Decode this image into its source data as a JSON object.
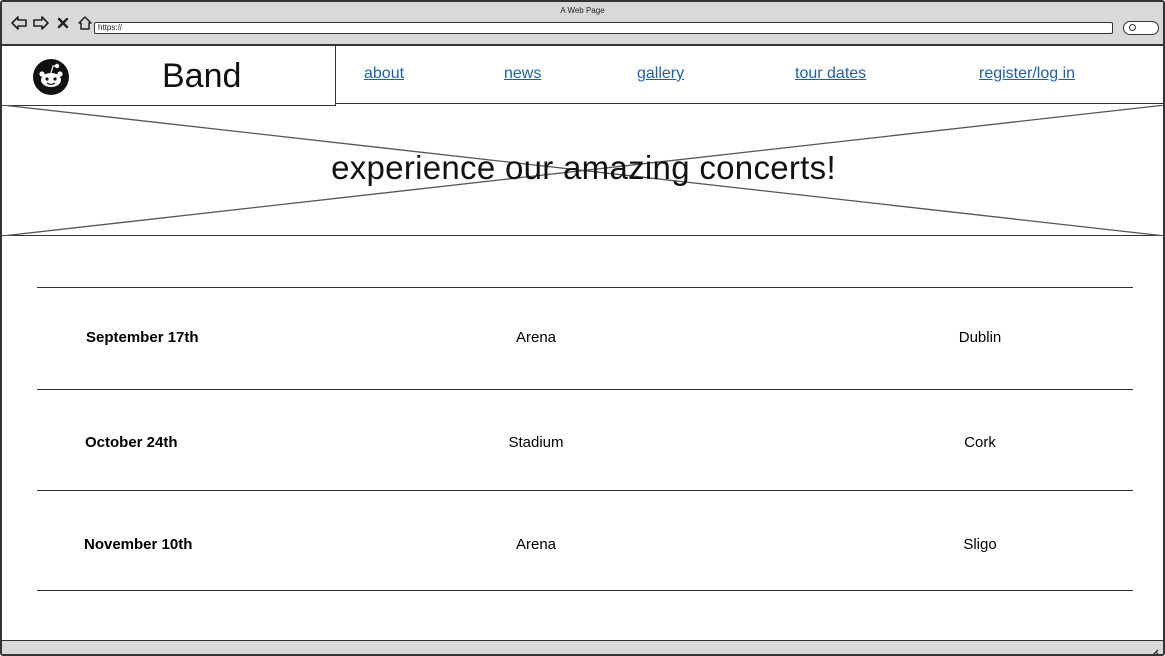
{
  "window": {
    "title": "A Web Page"
  },
  "browser": {
    "url": "https://",
    "nav_icons": [
      "back-icon",
      "forward-icon",
      "stop-icon",
      "home-icon"
    ],
    "search_icon": "search-icon"
  },
  "header": {
    "logo_icon": "reddit-alien-icon",
    "brand": "Band",
    "nav": [
      {
        "label": "about"
      },
      {
        "label": "news"
      },
      {
        "label": "gallery"
      },
      {
        "label": "tour dates"
      },
      {
        "label": "register/log in"
      }
    ]
  },
  "hero": {
    "title": "experience our amazing concerts!"
  },
  "tour": {
    "rows": [
      {
        "date": "September 17th",
        "venue": "Arena",
        "city": "Dublin"
      },
      {
        "date": "October 24th",
        "venue": "Stadium",
        "city": "Cork"
      },
      {
        "date": "November 10th",
        "venue": "Arena",
        "city": "Sligo"
      }
    ]
  },
  "colors": {
    "link": "#1f5fa8",
    "chrome": "#d9d9d9",
    "stroke": "#333333"
  }
}
